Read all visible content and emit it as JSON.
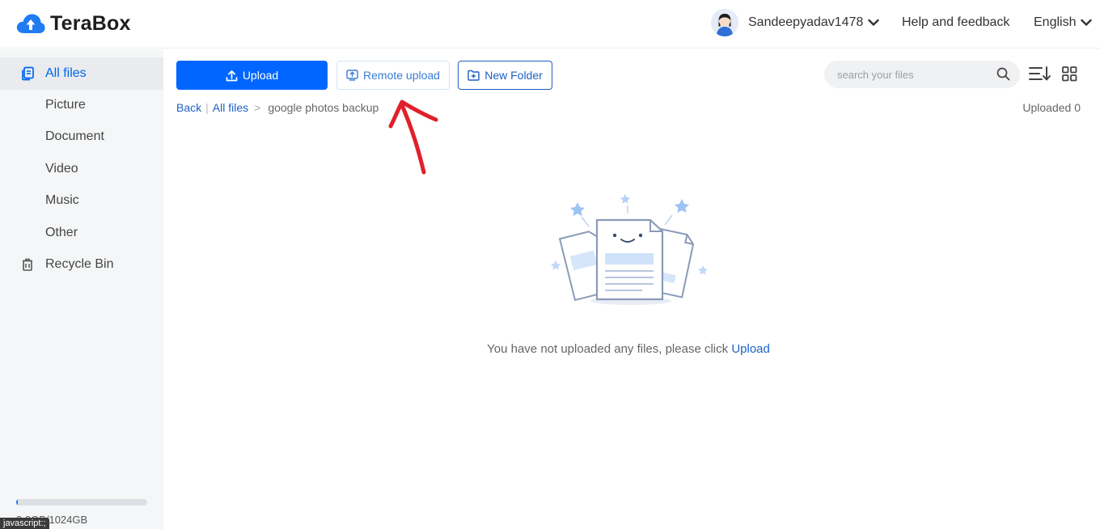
{
  "header": {
    "brand": "TeraBox",
    "username": "Sandeepyadav1478",
    "help": "Help and feedback",
    "language": "English"
  },
  "sidebar": {
    "items": [
      {
        "label": "All files",
        "icon": "all-files-icon",
        "active": true
      },
      {
        "label": "Picture"
      },
      {
        "label": "Document"
      },
      {
        "label": "Video"
      },
      {
        "label": "Music"
      },
      {
        "label": "Other"
      },
      {
        "label": "Recycle Bin",
        "icon": "trash-icon"
      }
    ],
    "storage_text": "0.0GB/1024GB",
    "storage_used_fraction": 0.0
  },
  "toolbar": {
    "upload_label": "Upload",
    "remote_upload_label": "Remote upload",
    "new_folder_label": "New Folder",
    "search_placeholder": "search your files"
  },
  "breadcrumb": {
    "back": "Back",
    "all_files": "All files",
    "current": "google photos backup"
  },
  "uploaded_status": "Uploaded 0",
  "empty_state": {
    "message": "You have not uploaded any files, please click",
    "link": "Upload"
  },
  "status_bar": "javascript:;",
  "colors": {
    "accent": "#0066ff",
    "link": "#1c62c7",
    "sidebar_bg": "#f5f6f7",
    "annotation": "#e0202a"
  }
}
